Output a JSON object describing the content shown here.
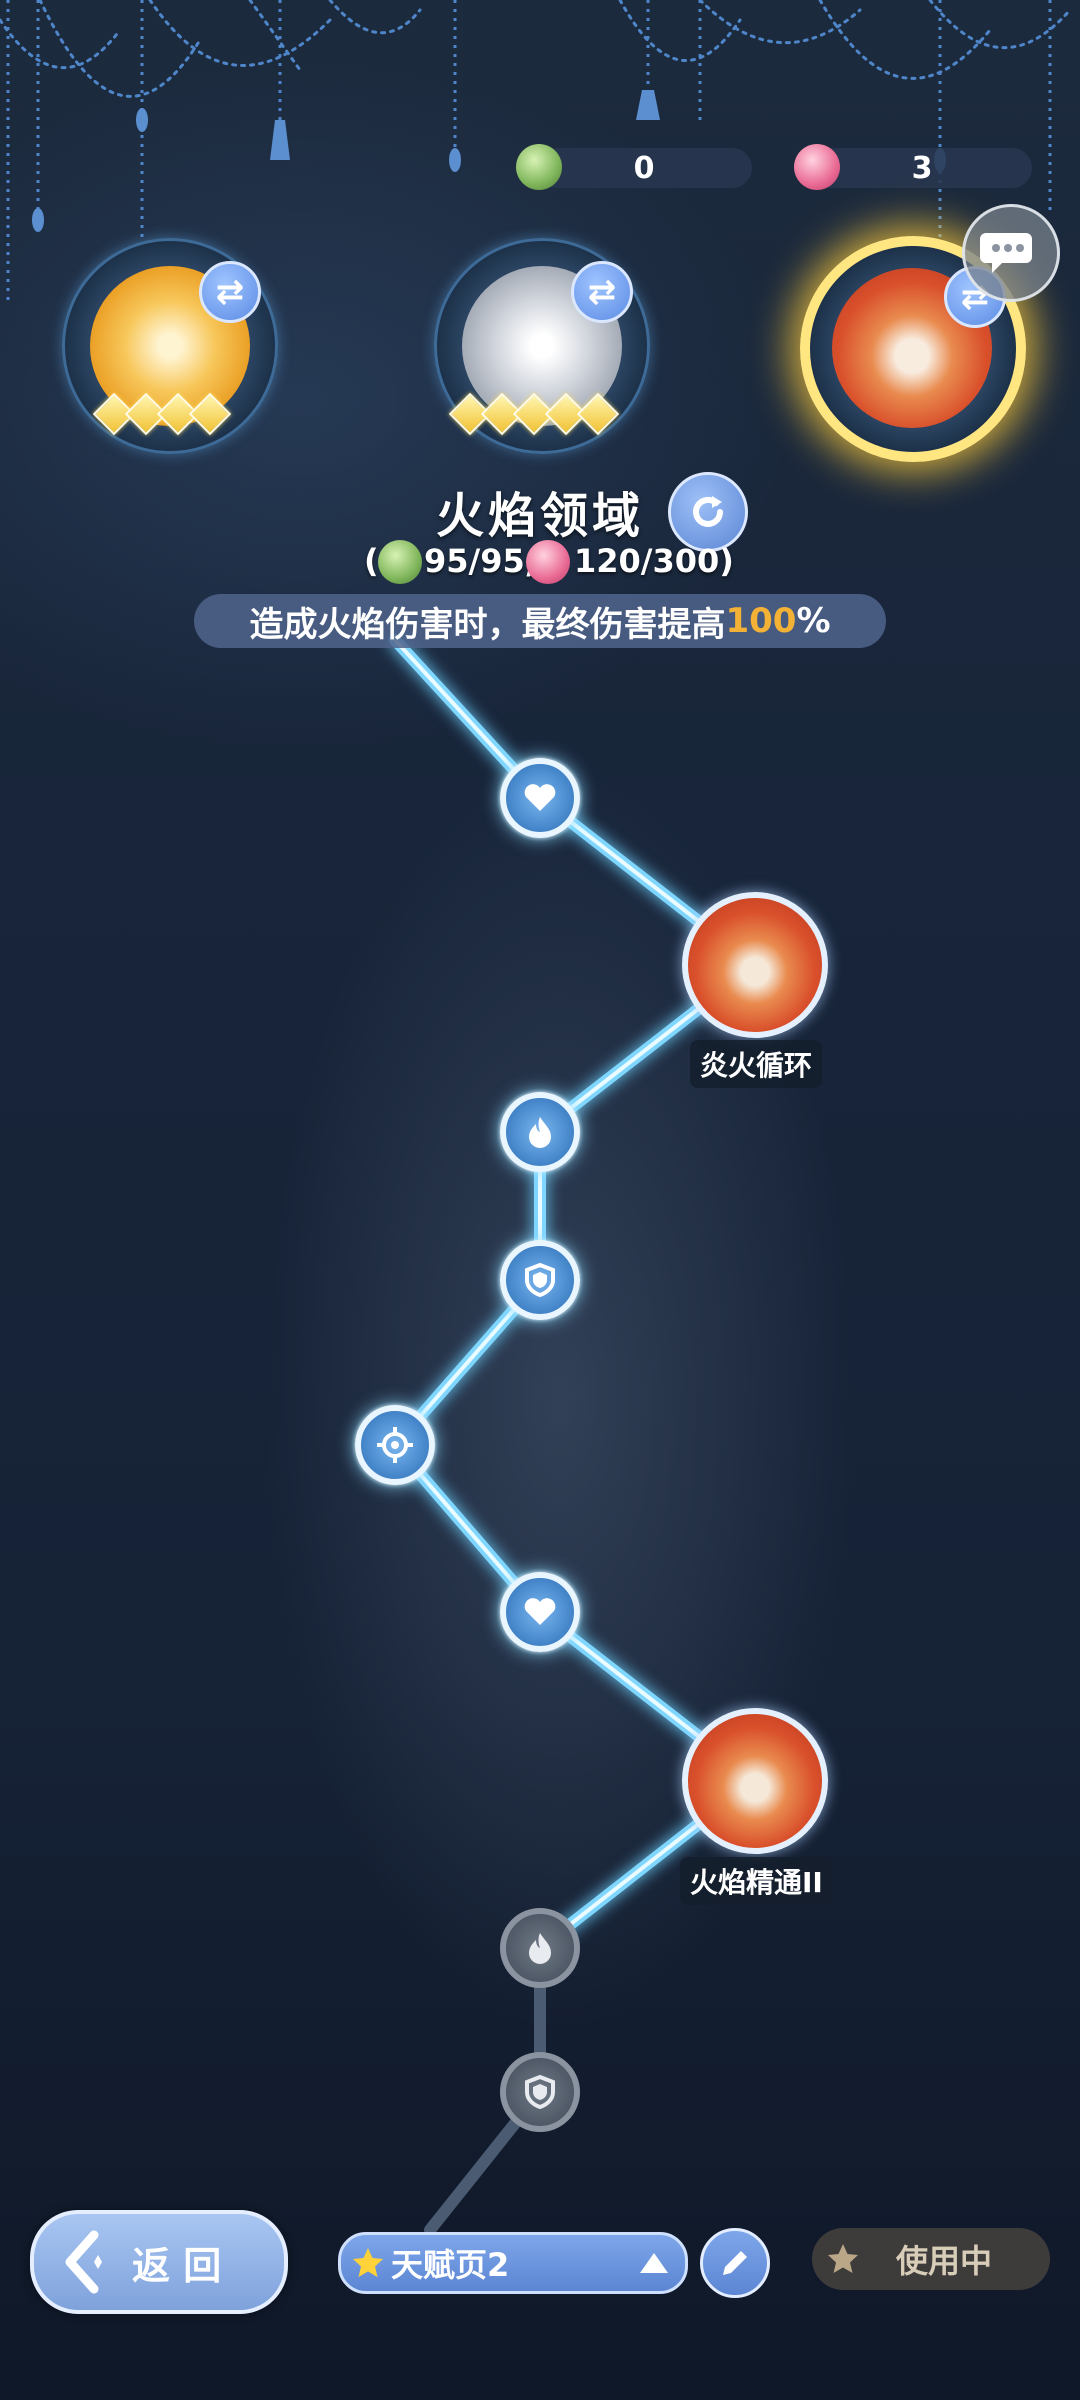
{
  "resources": {
    "green_count": "0",
    "pink_count": "3",
    "green_icon": "green-crystal-icon",
    "pink_icon": "pink-crystal-icon"
  },
  "talents": [
    {
      "name": "gold-talent",
      "gems": 4
    },
    {
      "name": "silver-talent",
      "gems": 5
    },
    {
      "name": "fire-talent",
      "gems": 0,
      "selected": true
    }
  ],
  "header": {
    "title": "火焰领域",
    "cost_prefix": "(",
    "cost_green": "95/95,",
    "cost_pink": "120/300)",
    "desc_main": "造成火焰伤害时，最终伤害提高",
    "desc_value": "100",
    "desc_suffix": "%"
  },
  "path": {
    "major_1_label": "炎火循环",
    "major_2_label": "火焰精通II"
  },
  "footer": {
    "back_label": "返 回",
    "page_label": "天赋页2",
    "in_use_label": "使用中"
  },
  "colors": {
    "accent": "#5c86d3",
    "highlight": "#f3b236",
    "selected_glow": "#ffd23a"
  }
}
